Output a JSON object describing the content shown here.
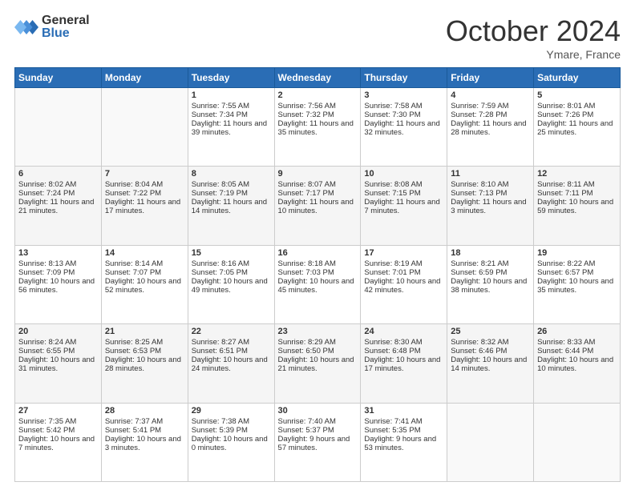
{
  "header": {
    "logo_general": "General",
    "logo_blue": "Blue",
    "month_title": "October 2024",
    "location": "Ymare, France"
  },
  "days_of_week": [
    "Sunday",
    "Monday",
    "Tuesday",
    "Wednesday",
    "Thursday",
    "Friday",
    "Saturday"
  ],
  "weeks": [
    [
      {
        "day": "",
        "content": ""
      },
      {
        "day": "",
        "content": ""
      },
      {
        "day": "1",
        "content": "Sunrise: 7:55 AM\nSunset: 7:34 PM\nDaylight: 11 hours and 39 minutes."
      },
      {
        "day": "2",
        "content": "Sunrise: 7:56 AM\nSunset: 7:32 PM\nDaylight: 11 hours and 35 minutes."
      },
      {
        "day": "3",
        "content": "Sunrise: 7:58 AM\nSunset: 7:30 PM\nDaylight: 11 hours and 32 minutes."
      },
      {
        "day": "4",
        "content": "Sunrise: 7:59 AM\nSunset: 7:28 PM\nDaylight: 11 hours and 28 minutes."
      },
      {
        "day": "5",
        "content": "Sunrise: 8:01 AM\nSunset: 7:26 PM\nDaylight: 11 hours and 25 minutes."
      }
    ],
    [
      {
        "day": "6",
        "content": "Sunrise: 8:02 AM\nSunset: 7:24 PM\nDaylight: 11 hours and 21 minutes."
      },
      {
        "day": "7",
        "content": "Sunrise: 8:04 AM\nSunset: 7:22 PM\nDaylight: 11 hours and 17 minutes."
      },
      {
        "day": "8",
        "content": "Sunrise: 8:05 AM\nSunset: 7:19 PM\nDaylight: 11 hours and 14 minutes."
      },
      {
        "day": "9",
        "content": "Sunrise: 8:07 AM\nSunset: 7:17 PM\nDaylight: 11 hours and 10 minutes."
      },
      {
        "day": "10",
        "content": "Sunrise: 8:08 AM\nSunset: 7:15 PM\nDaylight: 11 hours and 7 minutes."
      },
      {
        "day": "11",
        "content": "Sunrise: 8:10 AM\nSunset: 7:13 PM\nDaylight: 11 hours and 3 minutes."
      },
      {
        "day": "12",
        "content": "Sunrise: 8:11 AM\nSunset: 7:11 PM\nDaylight: 10 hours and 59 minutes."
      }
    ],
    [
      {
        "day": "13",
        "content": "Sunrise: 8:13 AM\nSunset: 7:09 PM\nDaylight: 10 hours and 56 minutes."
      },
      {
        "day": "14",
        "content": "Sunrise: 8:14 AM\nSunset: 7:07 PM\nDaylight: 10 hours and 52 minutes."
      },
      {
        "day": "15",
        "content": "Sunrise: 8:16 AM\nSunset: 7:05 PM\nDaylight: 10 hours and 49 minutes."
      },
      {
        "day": "16",
        "content": "Sunrise: 8:18 AM\nSunset: 7:03 PM\nDaylight: 10 hours and 45 minutes."
      },
      {
        "day": "17",
        "content": "Sunrise: 8:19 AM\nSunset: 7:01 PM\nDaylight: 10 hours and 42 minutes."
      },
      {
        "day": "18",
        "content": "Sunrise: 8:21 AM\nSunset: 6:59 PM\nDaylight: 10 hours and 38 minutes."
      },
      {
        "day": "19",
        "content": "Sunrise: 8:22 AM\nSunset: 6:57 PM\nDaylight: 10 hours and 35 minutes."
      }
    ],
    [
      {
        "day": "20",
        "content": "Sunrise: 8:24 AM\nSunset: 6:55 PM\nDaylight: 10 hours and 31 minutes."
      },
      {
        "day": "21",
        "content": "Sunrise: 8:25 AM\nSunset: 6:53 PM\nDaylight: 10 hours and 28 minutes."
      },
      {
        "day": "22",
        "content": "Sunrise: 8:27 AM\nSunset: 6:51 PM\nDaylight: 10 hours and 24 minutes."
      },
      {
        "day": "23",
        "content": "Sunrise: 8:29 AM\nSunset: 6:50 PM\nDaylight: 10 hours and 21 minutes."
      },
      {
        "day": "24",
        "content": "Sunrise: 8:30 AM\nSunset: 6:48 PM\nDaylight: 10 hours and 17 minutes."
      },
      {
        "day": "25",
        "content": "Sunrise: 8:32 AM\nSunset: 6:46 PM\nDaylight: 10 hours and 14 minutes."
      },
      {
        "day": "26",
        "content": "Sunrise: 8:33 AM\nSunset: 6:44 PM\nDaylight: 10 hours and 10 minutes."
      }
    ],
    [
      {
        "day": "27",
        "content": "Sunrise: 7:35 AM\nSunset: 5:42 PM\nDaylight: 10 hours and 7 minutes."
      },
      {
        "day": "28",
        "content": "Sunrise: 7:37 AM\nSunset: 5:41 PM\nDaylight: 10 hours and 3 minutes."
      },
      {
        "day": "29",
        "content": "Sunrise: 7:38 AM\nSunset: 5:39 PM\nDaylight: 10 hours and 0 minutes."
      },
      {
        "day": "30",
        "content": "Sunrise: 7:40 AM\nSunset: 5:37 PM\nDaylight: 9 hours and 57 minutes."
      },
      {
        "day": "31",
        "content": "Sunrise: 7:41 AM\nSunset: 5:35 PM\nDaylight: 9 hours and 53 minutes."
      },
      {
        "day": "",
        "content": ""
      },
      {
        "day": "",
        "content": ""
      }
    ]
  ]
}
